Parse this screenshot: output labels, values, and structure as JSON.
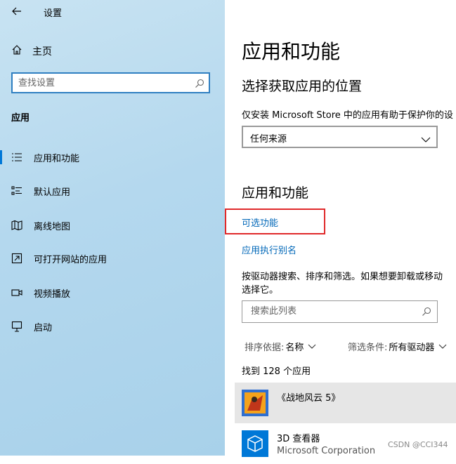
{
  "window": {
    "title": "设置"
  },
  "sidebar": {
    "home_label": "主页",
    "search_placeholder": "查找设置",
    "section_title": "应用",
    "items": [
      {
        "label": "应用和功能",
        "icon": "apps-features-icon",
        "active": true
      },
      {
        "label": "默认应用",
        "icon": "default-apps-icon",
        "active": false
      },
      {
        "label": "离线地图",
        "icon": "offline-maps-icon",
        "active": false
      },
      {
        "label": "可打开网站的应用",
        "icon": "apps-for-websites-icon",
        "active": false
      },
      {
        "label": "视频播放",
        "icon": "video-playback-icon",
        "active": false
      },
      {
        "label": "启动",
        "icon": "startup-icon",
        "active": false
      }
    ]
  },
  "main": {
    "page_title": "应用和功能",
    "install_section": {
      "title": "选择获取应用的位置",
      "description": "仅安装 Microsoft Store 中的应用有助于保护你的设",
      "dropdown_value": "任何来源"
    },
    "apps_section": {
      "title": "应用和功能",
      "link_optional_features": "可选功能",
      "link_app_aliases": "应用执行别名",
      "paragraph_line1": "按驱动器搜索、排序和筛选。如果想要卸载或移动",
      "paragraph_line2": "选择它。",
      "search_placeholder": "搜索此列表",
      "sort_label": "排序依据:",
      "sort_value": "名称",
      "filter_label": "筛选条件:",
      "filter_value": "所有驱动器",
      "count_text": "找到 128 个应用"
    },
    "apps": [
      {
        "name": "《战地风云 5》",
        "publisher": "",
        "icon": "battlefield-5-icon",
        "selected": true
      },
      {
        "name": "3D 查看器",
        "publisher": "Microsoft Corporation",
        "icon": "3d-viewer-icon",
        "selected": false
      }
    ]
  },
  "watermark": "CSDN @CCI344",
  "colors": {
    "accent": "#0078d7",
    "link": "#0067b8",
    "highlight_box": "#e0292a"
  }
}
